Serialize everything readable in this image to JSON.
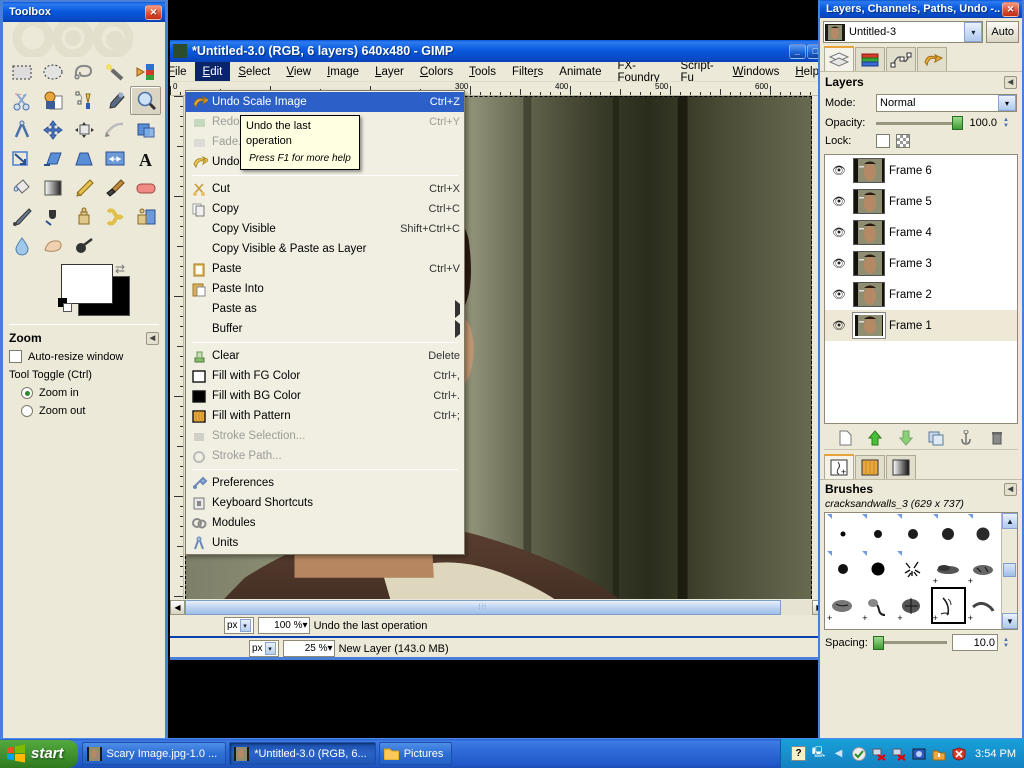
{
  "toolbox": {
    "title": "Toolbox",
    "close_label": "✕",
    "tools": [
      {
        "name": "rect-select-tool",
        "label": "Rectangle Select"
      },
      {
        "name": "ellipse-select-tool",
        "label": "Ellipse Select"
      },
      {
        "name": "free-select-tool",
        "label": "Free Select"
      },
      {
        "name": "fuzzy-select-tool",
        "label": "Fuzzy Select"
      },
      {
        "name": "select-by-color-tool",
        "label": "Select by Color"
      },
      {
        "name": "scissors-select-tool",
        "label": "Scissors Select"
      },
      {
        "name": "foreground-select-tool",
        "label": "Foreground Select"
      },
      {
        "name": "paths-tool",
        "label": "Paths"
      },
      {
        "name": "color-picker-tool",
        "label": "Color Picker"
      },
      {
        "name": "zoom-tool",
        "label": "Zoom"
      },
      {
        "name": "measure-tool",
        "label": "Measure"
      },
      {
        "name": "move-tool",
        "label": "Move"
      },
      {
        "name": "align-tool",
        "label": "Alignment"
      },
      {
        "name": "crop-tool",
        "label": "Crop"
      },
      {
        "name": "rotate-tool",
        "label": "Rotate"
      },
      {
        "name": "scale-tool",
        "label": "Scale"
      },
      {
        "name": "shear-tool",
        "label": "Shear"
      },
      {
        "name": "perspective-tool",
        "label": "Perspective"
      },
      {
        "name": "flip-tool",
        "label": "Flip"
      },
      {
        "name": "text-tool",
        "label": "Text"
      },
      {
        "name": "bucket-fill-tool",
        "label": "Bucket Fill"
      },
      {
        "name": "gradient-tool",
        "label": "Blend"
      },
      {
        "name": "pencil-tool",
        "label": "Pencil"
      },
      {
        "name": "paintbrush-tool",
        "label": "Paintbrush"
      },
      {
        "name": "eraser-tool",
        "label": "Eraser"
      },
      {
        "name": "airbrush-tool",
        "label": "Airbrush"
      },
      {
        "name": "ink-tool",
        "label": "Ink"
      },
      {
        "name": "clone-tool",
        "label": "Clone"
      },
      {
        "name": "heal-tool",
        "label": "Heal"
      },
      {
        "name": "perspective-clone-tool",
        "label": "Perspective Clone"
      },
      {
        "name": "blur-sharpen-tool",
        "label": "Blur / Sharpen"
      },
      {
        "name": "smudge-tool",
        "label": "Smudge"
      },
      {
        "name": "dodge-burn-tool",
        "label": "Dodge / Burn"
      }
    ],
    "selected_tool_index": 9,
    "colors": {
      "foreground": "#FFFFFF",
      "background": "#000000"
    },
    "options": {
      "title": "Zoom",
      "auto_resize_label": "Auto-resize window",
      "auto_resize_checked": false,
      "tool_toggle_label": "Tool Toggle  (Ctrl)",
      "radio_zoom_in": "Zoom in",
      "radio_zoom_out": "Zoom out",
      "selected_radio": "Zoom in"
    }
  },
  "gimp_window": {
    "title": "*Untitled-3.0 (RGB, 6 layers) 640x480 - GIMP",
    "minimize_label": "_",
    "maximize_label": "□",
    "menubar": [
      {
        "label": "File",
        "key": "F"
      },
      {
        "label": "Edit",
        "key": "E"
      },
      {
        "label": "Select",
        "key": "S"
      },
      {
        "label": "View",
        "key": "V"
      },
      {
        "label": "Image",
        "key": "I"
      },
      {
        "label": "Layer",
        "key": "L"
      },
      {
        "label": "Colors",
        "key": "C"
      },
      {
        "label": "Tools",
        "key": "T"
      },
      {
        "label": "Filters",
        "key": "R"
      },
      {
        "label": "Animate",
        "key": "A"
      },
      {
        "label": "FX-Foundry",
        "key": "X"
      },
      {
        "label": "Script-Fu",
        "key": "S"
      },
      {
        "label": "Windows",
        "key": "W"
      },
      {
        "label": "Help",
        "key": "H"
      }
    ],
    "active_menu": "Edit",
    "ruler_h_labels": [
      "0",
      "300",
      "400",
      "500",
      "600"
    ],
    "statusbar": {
      "unit": "px",
      "zoom": "100 %",
      "message": "Undo the last operation",
      "unit2": "px",
      "zoom2": "25 %",
      "message2": "New Layer (143.0 MB)"
    }
  },
  "edit_menu": {
    "items": [
      {
        "label": "Undo Scale Image",
        "key": "U",
        "accel": "Ctrl+Z",
        "icon": "undo-arrow-icon",
        "state": "highlighted"
      },
      {
        "label": "Redo",
        "key": "R",
        "accel": "Ctrl+Y",
        "icon": "redo-arrow-icon",
        "state": "disabled"
      },
      {
        "label": "Fade...",
        "key": "F",
        "accel": "",
        "icon": "fade-icon",
        "state": "disabled"
      },
      {
        "label": "Undo History",
        "key": "H",
        "accel": "",
        "icon": "undo-history-icon",
        "state": "normal"
      },
      {
        "separator": true
      },
      {
        "label": "Cut",
        "key": "t",
        "accel": "Ctrl+X",
        "icon": "scissors-icon",
        "state": "normal"
      },
      {
        "label": "Copy",
        "key": "C",
        "accel": "Ctrl+C",
        "icon": "copy-icon",
        "state": "normal"
      },
      {
        "label": "Copy Visible",
        "key": "V",
        "accel": "Shift+Ctrl+C",
        "icon": "",
        "state": "normal"
      },
      {
        "label": "Copy Visible & Paste as Layer",
        "key": "",
        "accel": "",
        "icon": "",
        "state": "normal"
      },
      {
        "label": "Paste",
        "key": "P",
        "accel": "Ctrl+V",
        "icon": "paste-icon",
        "state": "normal"
      },
      {
        "label": "Paste Into",
        "key": "I",
        "accel": "",
        "icon": "paste-into-icon",
        "state": "normal"
      },
      {
        "label": "Paste as",
        "key": "P",
        "accel": "",
        "icon": "",
        "state": "submenu"
      },
      {
        "label": "Buffer",
        "key": "B",
        "accel": "",
        "icon": "",
        "state": "submenu"
      },
      {
        "separator": true
      },
      {
        "label": "Clear",
        "key": "e",
        "accel": "Delete",
        "icon": "clear-icon",
        "state": "normal"
      },
      {
        "label": "Fill with FG Color",
        "key": "F",
        "accel": "Ctrl+,",
        "icon": "fg-color-swatch-icon",
        "state": "normal"
      },
      {
        "label": "Fill with BG Color",
        "key": "G",
        "accel": "Ctrl+.",
        "icon": "bg-color-swatch-icon",
        "state": "normal"
      },
      {
        "label": "Fill with Pattern",
        "key": "a",
        "accel": "Ctrl+;",
        "icon": "pattern-swatch-icon",
        "state": "normal"
      },
      {
        "label": "Stroke Selection...",
        "key": "S",
        "accel": "",
        "icon": "stroke-selection-icon",
        "state": "disabled"
      },
      {
        "label": "Stroke Path...",
        "key": "k",
        "accel": "",
        "icon": "stroke-path-icon",
        "state": "disabled"
      },
      {
        "separator": true
      },
      {
        "label": "Preferences",
        "key": "P",
        "accel": "",
        "icon": "preferences-icon",
        "state": "normal"
      },
      {
        "label": "Keyboard Shortcuts",
        "key": "K",
        "accel": "",
        "icon": "keyboard-icon",
        "state": "normal"
      },
      {
        "label": "Modules",
        "key": "M",
        "accel": "",
        "icon": "modules-icon",
        "state": "normal"
      },
      {
        "label": "Units",
        "key": "n",
        "accel": "",
        "icon": "units-icon",
        "state": "normal"
      }
    ]
  },
  "tooltip": {
    "text": "Undo the last operation",
    "hint": "Press F1 for more help"
  },
  "dock": {
    "title": "Layers, Channels, Paths, Undo -...",
    "close_label": "✕",
    "image_name": "Untitled-3",
    "auto_label": "Auto",
    "tabs": [
      {
        "name": "tab-layers",
        "label": "Layers"
      },
      {
        "name": "tab-channels",
        "label": "Channels"
      },
      {
        "name": "tab-paths",
        "label": "Paths"
      },
      {
        "name": "tab-undo-history",
        "label": "Undo History"
      }
    ],
    "active_tab": "Layers",
    "layers_panel": {
      "title": "Layers",
      "mode_label": "Mode:",
      "mode_value": "Normal",
      "opacity_label": "Opacity:",
      "opacity_value": "100.0",
      "lock_label": "Lock:",
      "layers": [
        {
          "name": "Frame 6",
          "visible": true,
          "selected": false
        },
        {
          "name": "Frame 5",
          "visible": true,
          "selected": false
        },
        {
          "name": "Frame 4",
          "visible": true,
          "selected": false
        },
        {
          "name": "Frame 3",
          "visible": true,
          "selected": false
        },
        {
          "name": "Frame 2",
          "visible": true,
          "selected": false
        },
        {
          "name": "Frame 1",
          "visible": true,
          "selected": true
        }
      ],
      "toolbar": [
        {
          "name": "new-layer-button",
          "icon": "page-icon"
        },
        {
          "name": "raise-layer-button",
          "icon": "up-arrow-icon"
        },
        {
          "name": "lower-layer-button",
          "icon": "down-arrow-icon"
        },
        {
          "name": "duplicate-layer-button",
          "icon": "duplicate-icon"
        },
        {
          "name": "anchor-layer-button",
          "icon": "anchor-icon"
        },
        {
          "name": "delete-layer-button",
          "icon": "trash-icon"
        }
      ]
    },
    "brushes_panel": {
      "tabs": [
        {
          "name": "tab-brushes",
          "label": "Brushes"
        },
        {
          "name": "tab-patterns",
          "label": "Patterns"
        },
        {
          "name": "tab-gradients",
          "label": "Gradients"
        }
      ],
      "active_tab": "Brushes",
      "title": "Brushes",
      "selected_brush": "cracksandwalls_3 (629 x 737)",
      "spacing_label": "Spacing:",
      "spacing_value": "10.0"
    }
  },
  "taskbar": {
    "start_label": "start",
    "items": [
      {
        "label": "Scary Image.jpg-1.0 ...",
        "active": false
      },
      {
        "label": "*Untitled-3.0 (RGB, 6...",
        "active": true
      },
      {
        "label": "Pictures",
        "active": false
      }
    ],
    "tray_icons": [
      "help-icon",
      "display-icon",
      "show-desktop-icon",
      "security-icon",
      "network-icon",
      "network2-icon",
      "update-icon",
      "warning-icon",
      "shield-icon"
    ],
    "clock": "3:54 PM"
  },
  "colors": {
    "xp_blue": "#0A56D6",
    "gimp_chrome": "#ECE9D8",
    "menu_highlight": "#2D5FC9",
    "tooltip_bg": "#FFFFE1",
    "taskbar_blue": "#2158C8",
    "start_green": "#43962F"
  }
}
